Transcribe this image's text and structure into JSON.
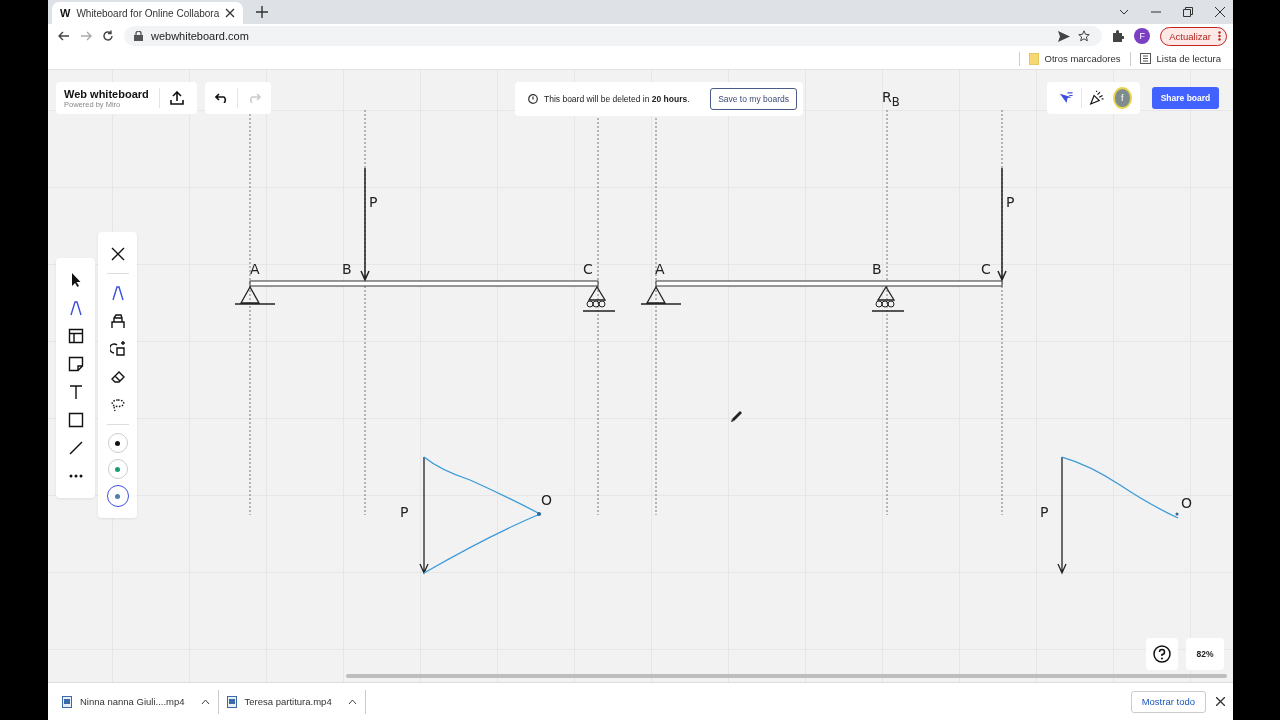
{
  "browser": {
    "tab": {
      "favicon": "W",
      "title": "Whiteboard for Online Collabora"
    },
    "url": "webwhiteboard.com",
    "profile": "F",
    "update_button": "Actualizar",
    "bookmarks": [
      "Otros marcadores",
      "Lista de lectura"
    ]
  },
  "board": {
    "title": "Web whiteboard",
    "subtitle": "Powered by Miro",
    "notice": "This board will be deleted in **20 hours**.",
    "save_button": "Save to my boards",
    "user_avatar": "f",
    "share_button": "Share board",
    "zoom": "82%"
  },
  "tools": [
    {
      "kind": "select",
      "selected": false
    },
    {
      "kind": "pen",
      "selected": true
    },
    {
      "kind": "template",
      "selected": false
    },
    {
      "kind": "sticky",
      "selected": false
    },
    {
      "kind": "text",
      "selected": false
    },
    {
      "kind": "shape",
      "selected": false
    },
    {
      "kind": "line",
      "selected": false
    },
    {
      "kind": "more",
      "selected": false
    }
  ],
  "pen_tools": [
    {
      "kind": "close",
      "selected": false
    },
    {
      "kind": "pen",
      "selected": true
    },
    {
      "kind": "highlighter",
      "selected": false
    },
    {
      "kind": "shape-pen",
      "selected": false
    },
    {
      "kind": "eraser",
      "selected": false
    },
    {
      "kind": "lasso",
      "selected": false
    }
  ],
  "pen_colors": [
    {
      "color": "#111111",
      "selected": false
    },
    {
      "color": "#1a9e6e",
      "selected": false
    },
    {
      "color": "#4a7fb0",
      "selected": true
    }
  ],
  "drawing": {
    "labels": [
      {
        "text": "A"
      },
      {
        "text": "B"
      },
      {
        "text": "C"
      },
      {
        "text": "P"
      },
      {
        "text": "A"
      },
      {
        "text": "B"
      },
      {
        "text": "C"
      },
      {
        "text": "P"
      },
      {
        "text": "R$_{B}$"
      },
      {
        "text": "P"
      },
      {
        "text": "O"
      },
      {
        "text": "P"
      },
      {
        "text": "O"
      }
    ]
  },
  "downloads": {
    "items": [
      {
        "name": "Ninna nanna Giuli....mp4"
      },
      {
        "name": "Teresa partitura.mp4"
      }
    ],
    "show_all": "Mostrar todo"
  }
}
